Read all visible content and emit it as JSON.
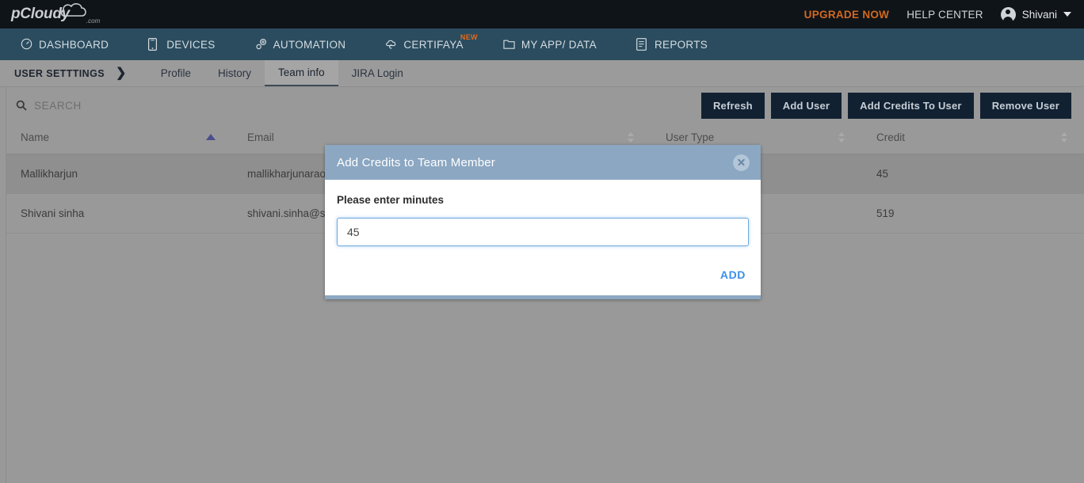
{
  "brand": {
    "logo_text": "pCloudy",
    "logo_suffix": ".com"
  },
  "topbar": {
    "upgrade_label": "UPGRADE NOW",
    "help_label": "HELP CENTER",
    "user_name": "Shivani",
    "avatar_icon": "user-circle-icon",
    "caret_icon": "chevron-down-icon",
    "upgrade_color": "#d2691e",
    "background": "#0f1419"
  },
  "mainnav": {
    "background": "#2b4c5f",
    "items": [
      {
        "label": "DASHBOARD",
        "icon": "speedometer-icon",
        "badge": ""
      },
      {
        "label": "DEVICES",
        "icon": "mobile-device-icon",
        "badge": ""
      },
      {
        "label": "AUTOMATION",
        "icon": "gears-icon",
        "badge": ""
      },
      {
        "label": "CERTIFAYA",
        "icon": "cloud-c-icon",
        "badge": "NEW"
      },
      {
        "label": "MY APP/ DATA",
        "icon": "folder-icon",
        "badge": ""
      },
      {
        "label": "REPORTS",
        "icon": "document-lines-icon",
        "badge": ""
      }
    ]
  },
  "subnav": {
    "title": "USER SETTTINGS",
    "chevron_icon": "chevron-right-icon",
    "tabs": [
      {
        "label": "Profile",
        "active": false
      },
      {
        "label": "History",
        "active": false
      },
      {
        "label": "Team info",
        "active": true
      },
      {
        "label": "JIRA Login",
        "active": false
      }
    ]
  },
  "toolbar": {
    "search_icon": "search-icon",
    "search_placeholder": "SEARCH",
    "search_value": "",
    "buttons": [
      {
        "label": "Refresh"
      },
      {
        "label": "Add User"
      },
      {
        "label": "Add Credits To User"
      },
      {
        "label": "Remove User"
      }
    ],
    "button_bg": "#122132"
  },
  "table": {
    "columns": [
      {
        "label": "Name",
        "sort": "asc"
      },
      {
        "label": "Email",
        "sort": "none"
      },
      {
        "label": "User Type",
        "sort": "none"
      },
      {
        "label": "Credit",
        "sort": "none"
      }
    ],
    "rows": [
      {
        "name": "Mallikharjun",
        "email": "mallikharjunarao.p",
        "user_type": "",
        "credit": "45",
        "selected": true
      },
      {
        "name": "Shivani sinha",
        "email": "shivani.sinha@ssts",
        "user_type": "",
        "credit": "519",
        "selected": false
      }
    ]
  },
  "modal": {
    "title": "Add Credits to Team Member",
    "close_icon": "close-circle-icon",
    "label": "Please enter minutes",
    "input_value": "45",
    "input_placeholder": "",
    "add_label": "ADD",
    "header_color": "#8ba7c2",
    "add_color": "#3b8fea"
  }
}
